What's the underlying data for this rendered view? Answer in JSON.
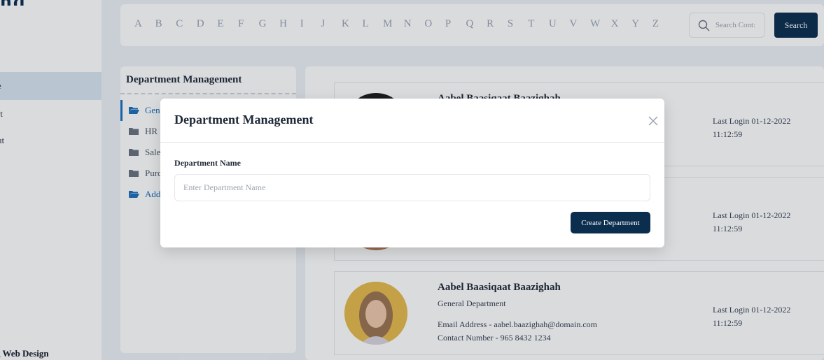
{
  "app": {
    "logo_text": "nq",
    "sidebar_items": [
      "e",
      "rt",
      "ut"
    ],
    "footer_brand": "Web Design"
  },
  "alphabet": [
    "A",
    "B",
    "C",
    "D",
    "E",
    "F",
    "G",
    "H",
    "I",
    "J",
    "K",
    "L",
    "M",
    "N",
    "O",
    "P",
    "Q",
    "R",
    "S",
    "T",
    "U",
    "V",
    "W",
    "X",
    "Y",
    "Z"
  ],
  "search": {
    "placeholder": "Search Cont:",
    "button_label": "Search"
  },
  "departments": {
    "title": "Department Management",
    "items": [
      {
        "label": "Gen"
      },
      {
        "label": "HR I"
      },
      {
        "label": "Sale"
      },
      {
        "label": "Purc"
      }
    ],
    "add_label": "Add"
  },
  "contacts": [
    {
      "name": "Aabel Baasiqaat Baazighah",
      "department": "",
      "email": "",
      "phone": "",
      "last_login": "Last Login 01-12-2022",
      "last_login_time": "11:12:59"
    },
    {
      "name": "",
      "department": "",
      "email": "",
      "phone": "",
      "last_login": "Last Login 01-12-2022",
      "last_login_time": "11:12:59"
    },
    {
      "name": "Aabel Baasiqaat Baazighah",
      "department": "General Department",
      "email": "Email Address - aabel.baazighah@domain.com",
      "phone": "Contact Number - 965 8432 1234",
      "last_login": "Last Login 01-12-2022",
      "last_login_time": "11:12:59"
    }
  ],
  "modal": {
    "title": "Department Management",
    "field_label": "Department Name",
    "field_placeholder": "Enter Department Name",
    "field_value": "",
    "submit_label": "Create Department"
  },
  "colors": {
    "primary": "#0b2e4f",
    "link": "#1d6fb8",
    "background": "#eef1f6"
  }
}
